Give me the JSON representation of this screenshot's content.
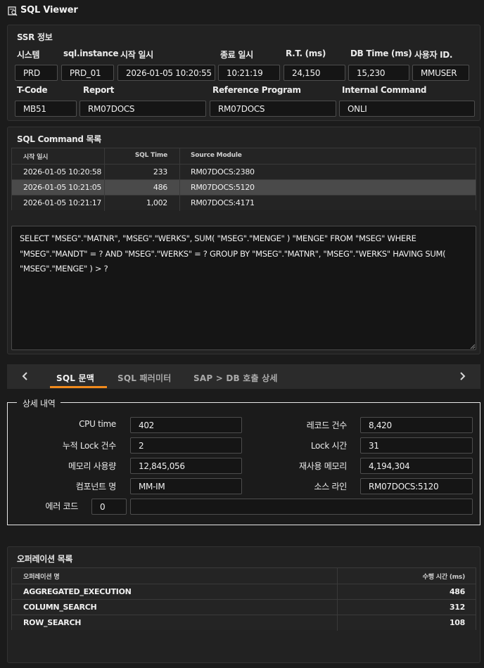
{
  "window": {
    "title": "SQL Viewer",
    "icon": "sql-search-icon"
  },
  "ssr": {
    "title": "SSR 정보",
    "fields": [
      {
        "label": "시스템",
        "value": "PRD"
      },
      {
        "label": "sql.instance",
        "value": "PRD_01"
      },
      {
        "label": "시작 일시",
        "value": "2026-01-05 10:20:55"
      },
      {
        "label": "종료 일시",
        "value": "10:21:19"
      },
      {
        "label": "R.T. (ms)",
        "value": "24,150"
      },
      {
        "label": "DB Time (ms)",
        "value": "15,230"
      },
      {
        "label": "사용자 ID.",
        "value": "MMUSER"
      },
      {
        "label": "T-Code",
        "value": "MB51"
      },
      {
        "label": "Report",
        "value": "RM07DOCS"
      },
      {
        "label": "Reference Program",
        "value": "RM07DOCS"
      },
      {
        "label": "Internal Command",
        "value": "ONLI"
      }
    ]
  },
  "sql_command": {
    "title": "SQL Command 목록",
    "columns": [
      "시작 일시",
      "SQL Time",
      "Source Module"
    ],
    "rows": [
      {
        "start": "2026-01-05 10:20:58",
        "time": "233",
        "module": "RM07DOCS:2380"
      },
      {
        "start": "2026-01-05 10:21:05",
        "time": "486",
        "module": "RM07DOCS:5120"
      },
      {
        "start": "2026-01-05 10:21:17",
        "time": "1,002",
        "module": "RM07DOCS:4171"
      }
    ],
    "selected_row": 1,
    "sql_text": "SELECT \"MSEG\".\"MATNR\", \"MSEG\".\"WERKS\", SUM( \"MSEG\".\"MENGE\" ) \"MENGE\" FROM \"MSEG\" WHERE \"MSEG\".\"MANDT\" = ? AND \"MSEG\".\"WERKS\" = ? GROUP BY \"MSEG\".\"MATNR\", \"MSEG\".\"WERKS\" HAVING SUM( \"MSEG\".\"MENGE\" ) > ?"
  },
  "tabs": {
    "prev_icon": "chevron-left-icon",
    "next_icon": "chevron-right-icon",
    "items": [
      "SQL 문맥",
      "SQL 패러미터",
      "SAP > DB 호출 상세"
    ],
    "active": 0,
    "accent": "#f08a1c"
  },
  "detail": {
    "title": "상세 내역",
    "left": [
      {
        "label": "CPU time",
        "value": "402"
      },
      {
        "label": "누적 Lock 건수",
        "value": "2"
      },
      {
        "label": "메모리 사용량",
        "value": "12,845,056"
      },
      {
        "label": "컴포넌트 명",
        "value": "MM-IM"
      }
    ],
    "right": [
      {
        "label": "레코드 건수",
        "value": "8,420"
      },
      {
        "label": "Lock 시간",
        "value": "31"
      },
      {
        "label": "재사용 메모리",
        "value": "4,194,304"
      },
      {
        "label": "소스 라인",
        "value": "RM07DOCS:5120"
      }
    ],
    "error": {
      "label": "에러 코드",
      "code": "0",
      "message": ""
    }
  },
  "operations": {
    "title": "오퍼레이션 목록",
    "columns": [
      "오퍼레이션 명",
      "수행 시간 (ms)"
    ],
    "rows": [
      {
        "name": "AGGREGATED_EXECUTION",
        "time": "486"
      },
      {
        "name": "COLUMN_SEARCH",
        "time": "312"
      },
      {
        "name": "ROW_SEARCH",
        "time": "108"
      }
    ]
  }
}
